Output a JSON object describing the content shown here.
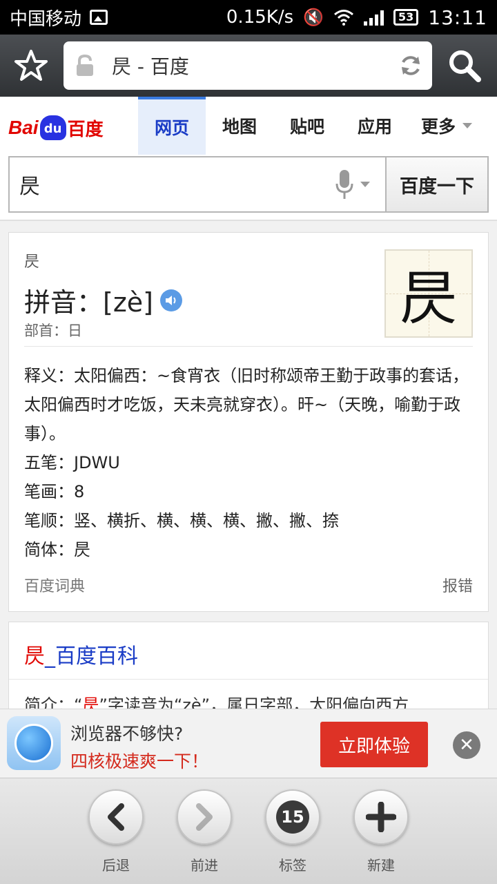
{
  "status_bar": {
    "carrier": "中国移动",
    "speed": "0.15K/s",
    "battery": "53",
    "time": "13:11"
  },
  "browser": {
    "url_title": "昃 - 百度"
  },
  "baidu": {
    "logo_text_en": "Bai",
    "logo_paw": "du",
    "logo_text_zh": "百度",
    "tabs": [
      "网页",
      "地图",
      "贴吧",
      "应用",
      "更多"
    ],
    "active_tab": "网页",
    "search_value": "昃",
    "search_button": "百度一下"
  },
  "dict_card": {
    "char_small": "昃",
    "pinyin": "拼音：[zè]",
    "radical": "部首：日",
    "big_char": "昃",
    "lines": [
      "释义：太阳偏西：~食宵衣（旧时称颂帝王勤于政事的套话，太阳偏西时才吃饭，天未亮就穿衣）。旰~（天晚，喻勤于政事）。",
      "五笔：JDWU",
      "笔画：8",
      "笔顺：竖、横折、横、横、横、撇、撇、捺",
      "简体：昃"
    ],
    "source": "百度词典",
    "report": "报错"
  },
  "baike_card": {
    "title_hl": "昃",
    "title_rest": "_百度百科",
    "snippet_prefix": "简介：“",
    "snippet_hl": "昃",
    "snippet_rest": "”字读音为“zè”，属日字部，太阳偏向西方"
  },
  "ad": {
    "line1": "浏览器不够快?",
    "line2": "四核极速爽一下！",
    "cta": "立即体验"
  },
  "bottom_nav": {
    "back": "后退",
    "forward": "前进",
    "tabs_count": "15",
    "tabs": "标签",
    "new": "新建"
  }
}
